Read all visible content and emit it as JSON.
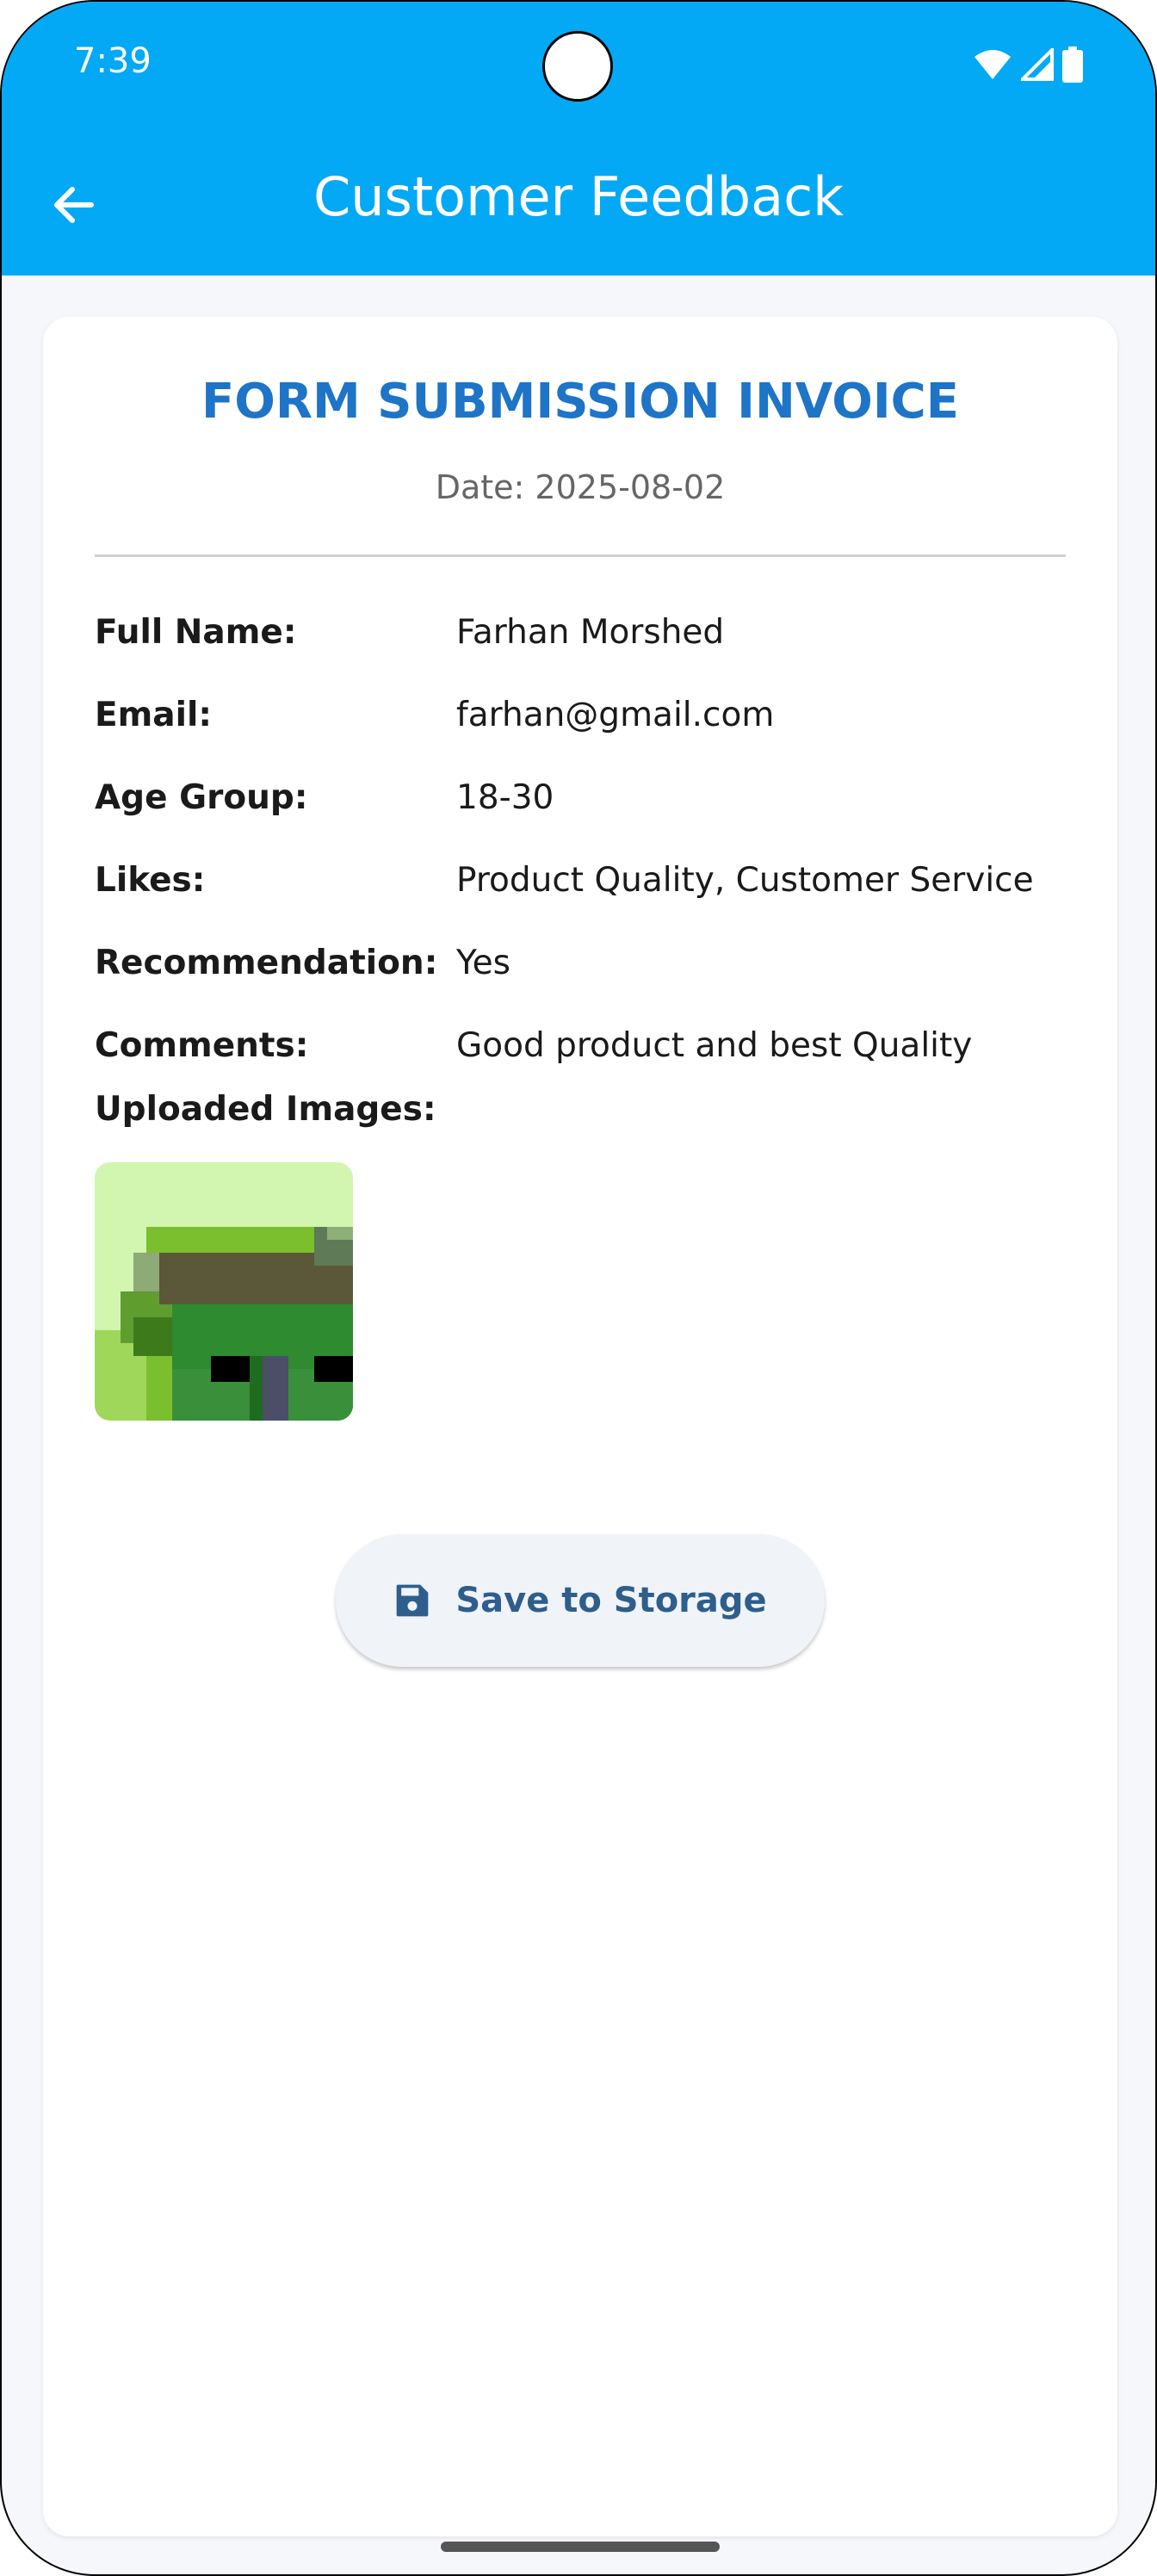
{
  "status_bar": {
    "time": "7:39",
    "icons": [
      "wifi-icon",
      "signal-icon",
      "battery-icon"
    ]
  },
  "app_bar": {
    "title": "Customer Feedback",
    "back_icon": "arrow-back-icon",
    "color": "#03A9F4"
  },
  "invoice": {
    "title": "FORM SUBMISSION INVOICE",
    "date": "Date: 2025-08-02",
    "title_color": "#1E74C7",
    "fields": [
      {
        "label": "Full Name:",
        "value": "Farhan Morshed"
      },
      {
        "label": "Email:",
        "value": "farhan@gmail.com"
      },
      {
        "label": "Age Group:",
        "value": "18-30"
      },
      {
        "label": "Likes:",
        "value": "Product Quality, Customer Service"
      },
      {
        "label": "Recommendation:",
        "value": "Yes"
      },
      {
        "label": "Comments:",
        "value": "Good product and best Quality"
      }
    ],
    "uploaded_images_label": "Uploaded Images:",
    "images": [
      "uploaded-image-1"
    ]
  },
  "actions": {
    "save_label": "Save to Storage",
    "save_icon": "save-icon"
  }
}
